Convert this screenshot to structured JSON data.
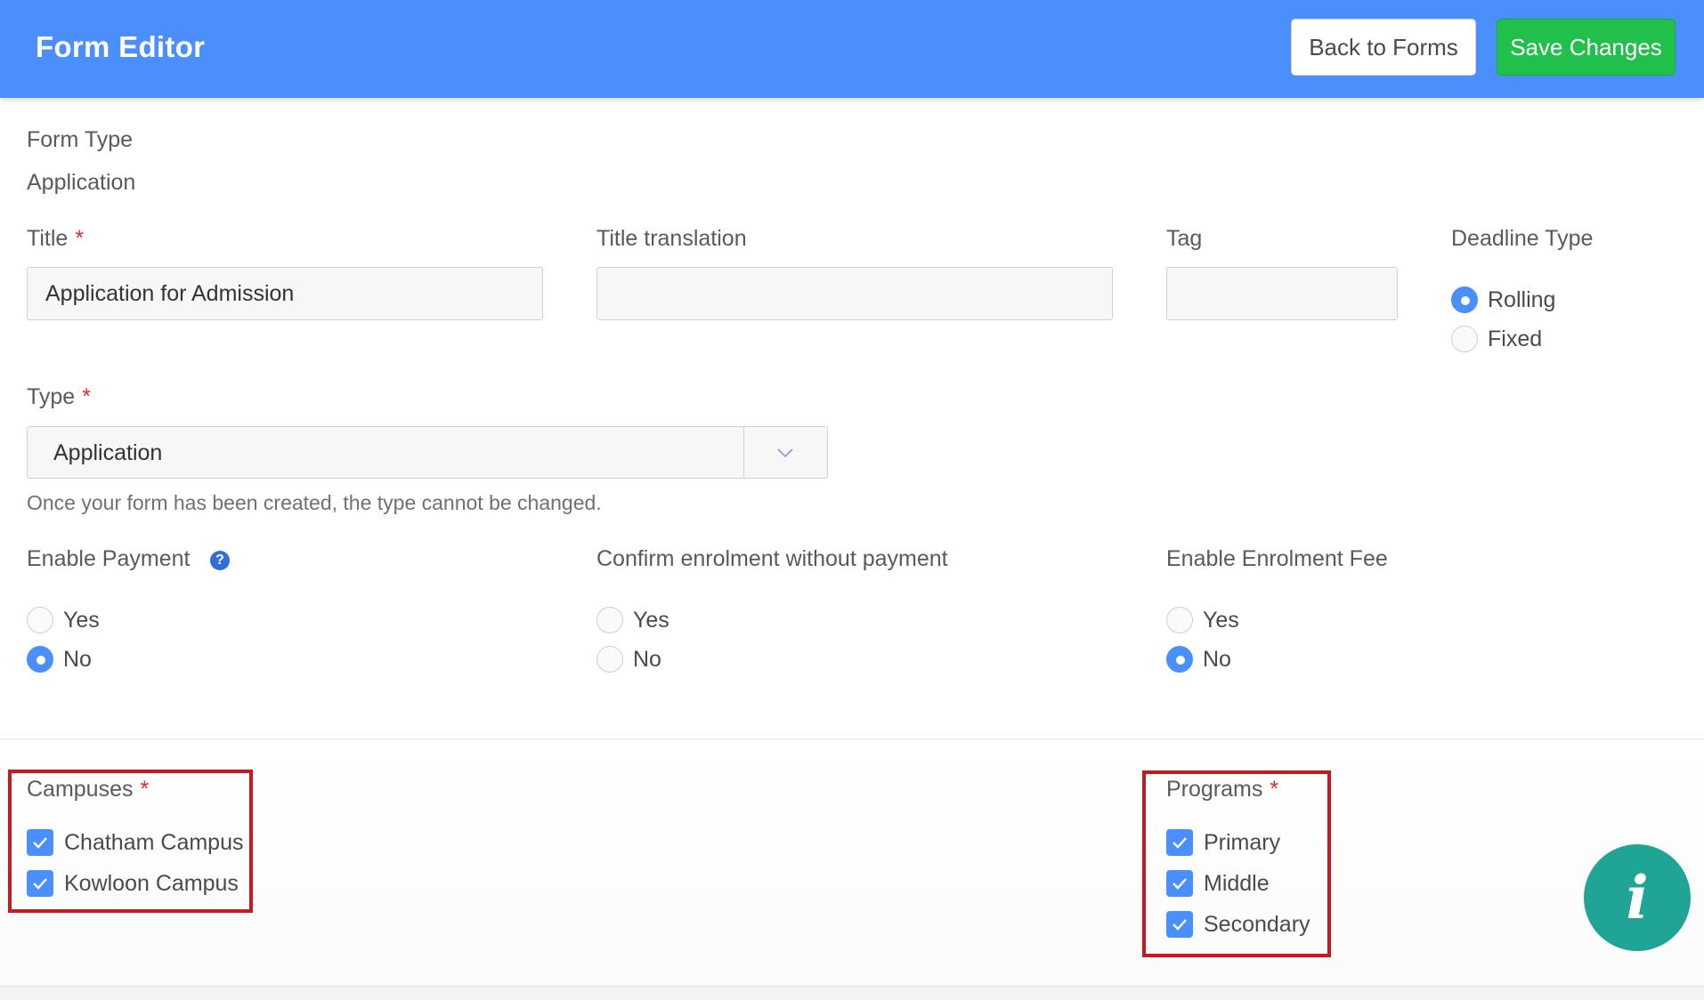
{
  "header": {
    "title": "Form Editor",
    "back_label": "Back to Forms",
    "save_label": "Save Changes",
    "bar_color": "#4a8ffc",
    "save_color": "#21c04b"
  },
  "form": {
    "form_type": {
      "label": "Form Type",
      "value": "Application"
    },
    "title": {
      "label": "Title",
      "required_mark": "*",
      "value": "Application for Admission"
    },
    "title_translation": {
      "label": "Title translation",
      "value": ""
    },
    "tag": {
      "label": "Tag",
      "value": ""
    },
    "deadline_type": {
      "label": "Deadline Type",
      "options": [
        "Rolling",
        "Fixed"
      ],
      "selected": "Rolling"
    },
    "type": {
      "label": "Type",
      "required_mark": "*",
      "value": "Application",
      "hint": "Once your form has been created, the type cannot be changed.",
      "icon": "chevron-down-icon"
    },
    "enable_payment": {
      "label": "Enable Payment",
      "help_icon": "question-circle-icon",
      "help_glyph": "?",
      "options": [
        "Yes",
        "No"
      ],
      "selected": "No"
    },
    "confirm_without_payment": {
      "label": "Confirm enrolment without payment",
      "options": [
        "Yes",
        "No"
      ],
      "selected": ""
    },
    "enable_enrolment_fee": {
      "label": "Enable Enrolment Fee",
      "options": [
        "Yes",
        "No"
      ],
      "selected": "No"
    },
    "campuses": {
      "label": "Campuses",
      "required_mark": "*",
      "items": [
        {
          "label": "Chatham Campus",
          "checked": true
        },
        {
          "label": "Kowloon Campus",
          "checked": true
        }
      ]
    },
    "programs": {
      "label": "Programs",
      "required_mark": "*",
      "items": [
        {
          "label": "Primary",
          "checked": true
        },
        {
          "label": "Middle",
          "checked": true
        },
        {
          "label": "Secondary",
          "checked": true
        }
      ]
    }
  },
  "info_button": {
    "glyph": "i",
    "icon": "info-icon",
    "color": "#1fa496"
  },
  "highlight_color": "#c9181e"
}
